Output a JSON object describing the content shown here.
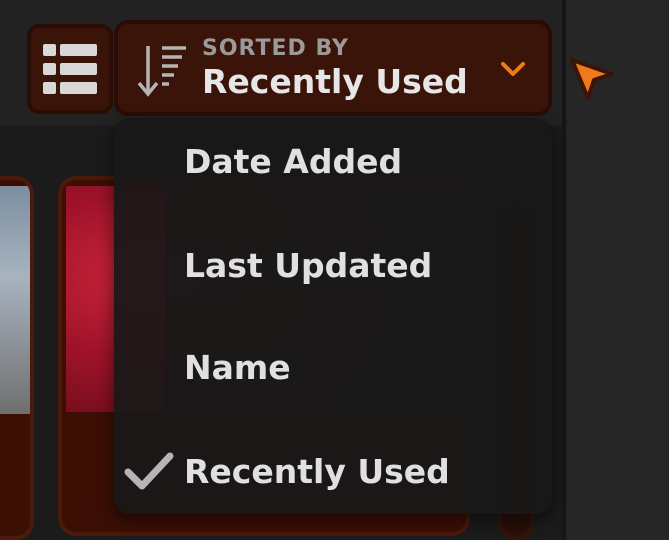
{
  "header": {
    "sort": {
      "caption": "SORTED BY",
      "value": "Recently Used"
    }
  },
  "sort_menu": {
    "items": [
      {
        "label": "Date Added",
        "checked": false
      },
      {
        "label": "Last Updated",
        "checked": false
      },
      {
        "label": "Name",
        "checked": false
      },
      {
        "label": "Recently Used",
        "checked": true
      }
    ]
  },
  "colors": {
    "accent": "#f07a1a",
    "button_bg": "#3a1408",
    "menu_bg": "#181818",
    "text": "#e0e0e0",
    "caption": "#9a9a9a"
  },
  "icons": {
    "view_toggle": "list-view-icon",
    "sort": "sort-descending-icon",
    "dropdown": "chevron-down-icon",
    "selected": "checkmark-icon",
    "pointer": "cursor-arrow-icon"
  }
}
